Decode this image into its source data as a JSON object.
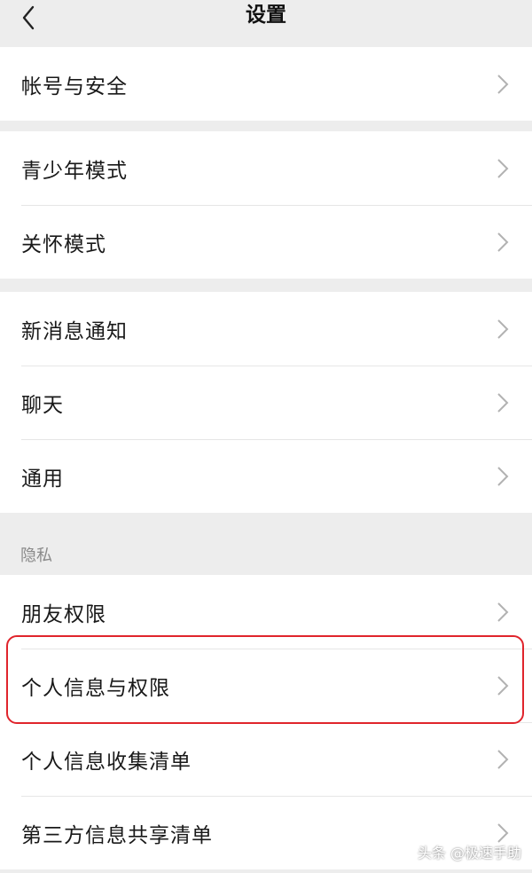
{
  "header": {
    "title": "设置"
  },
  "groups": [
    {
      "items": [
        {
          "label": "帐号与安全"
        }
      ]
    },
    {
      "items": [
        {
          "label": "青少年模式"
        },
        {
          "label": "关怀模式"
        }
      ]
    },
    {
      "items": [
        {
          "label": "新消息通知"
        },
        {
          "label": "聊天"
        },
        {
          "label": "通用"
        }
      ]
    },
    {
      "items": [
        {
          "label": "朋友权限"
        },
        {
          "label": "个人信息与权限"
        },
        {
          "label": "个人信息收集清单"
        },
        {
          "label": "第三方信息共享清单"
        }
      ]
    }
  ],
  "privacy_section": {
    "label": "隐私"
  },
  "watermark": {
    "text": "头条 @极速手助"
  },
  "colors": {
    "background": "#ededed",
    "card": "#ffffff",
    "highlight": "#e0242c"
  }
}
